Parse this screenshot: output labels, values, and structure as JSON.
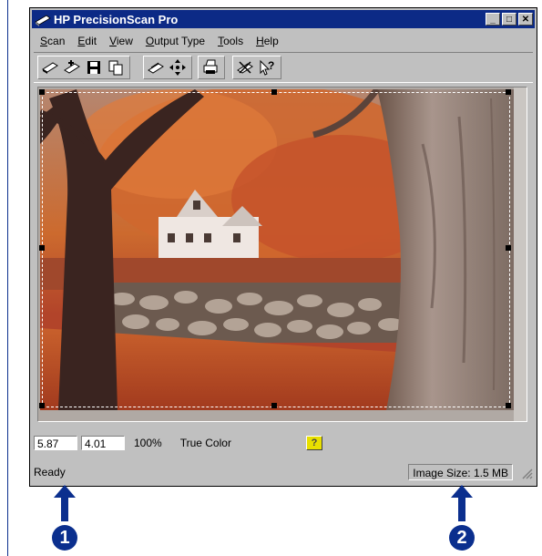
{
  "window": {
    "title": "HP PrecisionScan Pro",
    "controls": {
      "minimize": "_",
      "maximize": "□",
      "close": "✕"
    }
  },
  "menu": {
    "items": [
      {
        "label_u": "S",
        "label_rest": "can"
      },
      {
        "label_u": "E",
        "label_rest": "dit"
      },
      {
        "label_u": "V",
        "label_rest": "iew"
      },
      {
        "label_u": "O",
        "label_rest": "utput Type"
      },
      {
        "label_u": "T",
        "label_rest": "ools"
      },
      {
        "label_u": "H",
        "label_rest": "elp"
      }
    ]
  },
  "toolbar": {
    "icons": [
      "scan-icon",
      "scan-add-icon",
      "save-icon",
      "copy-icon",
      "resize-icon",
      "move-icon",
      "print-icon",
      "erase-selection-icon",
      "context-help-icon"
    ]
  },
  "statusbar": {
    "width_value": "5.87",
    "height_value": "4.01",
    "zoom": "100%",
    "color_mode": "True Color",
    "help_glyph": "?",
    "state": "Ready",
    "image_size": "Image Size: 1.5 MB"
  },
  "callouts": {
    "one": "1",
    "two": "2"
  },
  "colors": {
    "accent": "#0b2f8e",
    "titlebar": "#0c2a86"
  }
}
